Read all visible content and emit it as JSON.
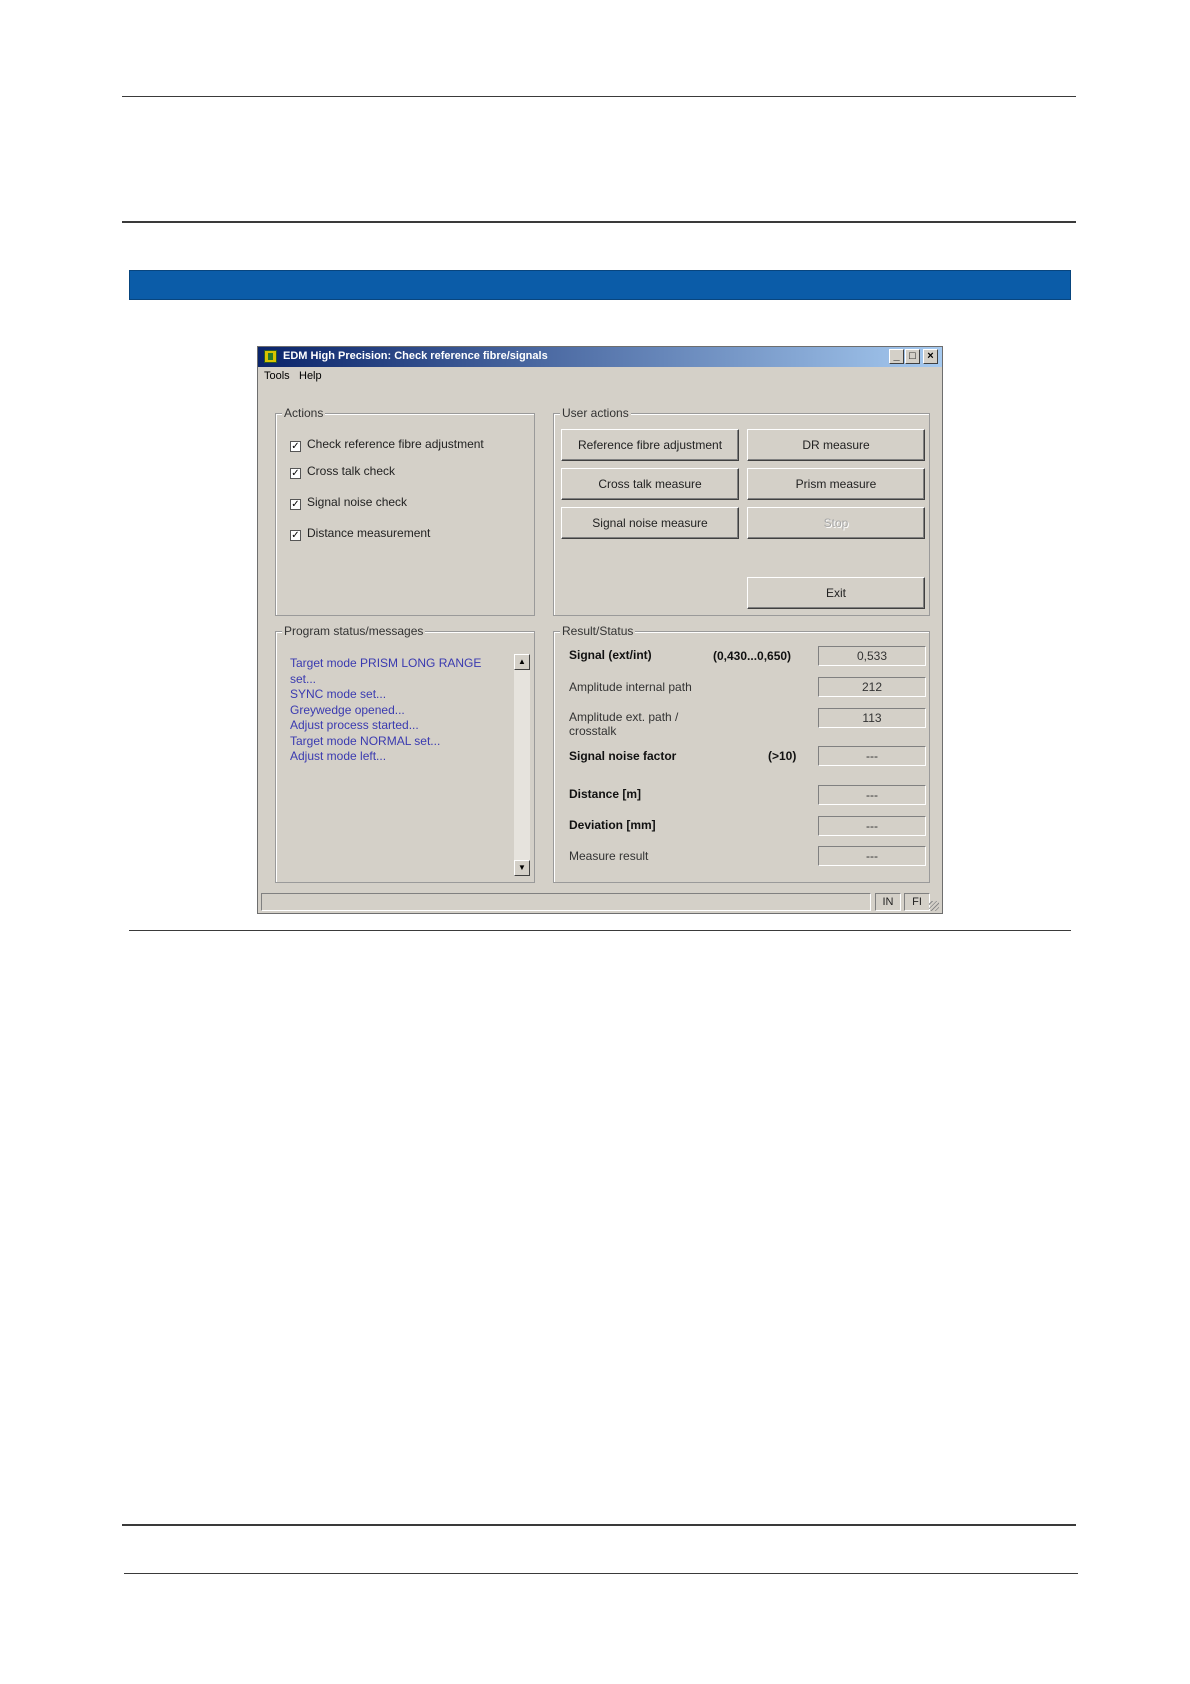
{
  "window": {
    "title": "EDM High Precision: Check reference fibre/signals",
    "controls": {
      "minimize": "_",
      "maximize": "□",
      "close": "×"
    }
  },
  "menu": [
    "Tools",
    "Help"
  ],
  "actions": {
    "label": "Actions",
    "items": [
      {
        "label": "Check reference fibre adjustment",
        "checked": true
      },
      {
        "label": "Cross talk check",
        "checked": true
      },
      {
        "label": "Signal noise check",
        "checked": true
      },
      {
        "label": "Distance measurement",
        "checked": true
      }
    ],
    "check_mark": "✓"
  },
  "user_actions": {
    "label": "User actions",
    "reference_fibre_adjustment": "Reference fibre adjustment",
    "dr_measure": "DR measure",
    "cross_talk_measure": "Cross talk measure",
    "prism_measure": "Prism measure",
    "signal_noise_measure": "Signal noise measure",
    "stop": "Stop",
    "exit": "Exit"
  },
  "program_status": {
    "label": "Program status/messages",
    "messages": [
      "Target mode PRISM LONG RANGE set...",
      "SYNC mode set...",
      "Greywedge opened...",
      "Adjust process started...",
      "Target mode NORMAL set...",
      "Adjust mode left..."
    ],
    "scroll_up": "▲",
    "scroll_down": "▼"
  },
  "result_status": {
    "label": "Result/Status",
    "signal_label": "Signal (ext/int)",
    "signal_range": "(0,430...0,650)",
    "signal_value": "0,533",
    "amp_internal_label": "Amplitude internal path",
    "amp_internal_value": "212",
    "amp_ext_label": "Amplitude ext. path / crosstalk",
    "amp_ext_value": "113",
    "noise_label": "Signal noise factor",
    "noise_range": "(>10)",
    "noise_value": "---",
    "distance_label": "Distance [m]",
    "distance_value": "---",
    "deviation_label": "Deviation [mm]",
    "deviation_value": "---",
    "measure_label": "Measure result",
    "measure_value": "---"
  },
  "statusbar": {
    "pane1": "IN",
    "pane2": "FI"
  }
}
